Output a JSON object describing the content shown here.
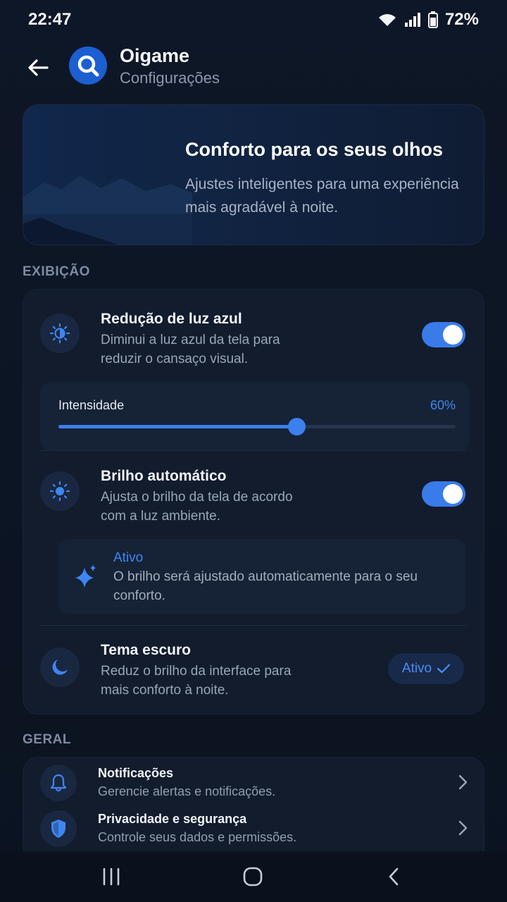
{
  "status": {
    "time": "22:47",
    "battery": "72%"
  },
  "header": {
    "title": "Oigame",
    "subtitle": "Configurações"
  },
  "hero": {
    "title": "Conforto para os seus olhos",
    "description": "Ajustes inteligentes para uma experiência mais agradável à noite."
  },
  "sections": {
    "display": "EXIBIÇÃO",
    "general": "GERAL"
  },
  "blue_light": {
    "title": "Redução de luz azul",
    "description": "Diminui a luz azul da tela para reduzir o cansaço visual.",
    "enabled": true,
    "intensity_label": "Intensidade",
    "intensity_value": "60%",
    "intensity_fraction": 0.6
  },
  "auto_brightness": {
    "title": "Brilho automático",
    "description": "Ajusta o brilho da tela de acordo com a luz ambiente.",
    "enabled": true,
    "info_title": "Ativo",
    "info_description": "O brilho será ajustado automaticamente para o seu conforto."
  },
  "dark_theme": {
    "title": "Tema escuro",
    "description": "Reduz o brilho da interface para mais conforto à noite.",
    "badge": "Ativo"
  },
  "general": {
    "items": [
      {
        "title": "Notificações",
        "description": "Gerencie alertas e notificações.",
        "icon": "bell-icon"
      },
      {
        "title": "Privacidade e segurança",
        "description": "Controle seus dados e permissões.",
        "icon": "shield-icon"
      }
    ]
  },
  "colors": {
    "accent": "#3b7fec",
    "background": "#0d1524",
    "card": "#121c2d"
  }
}
